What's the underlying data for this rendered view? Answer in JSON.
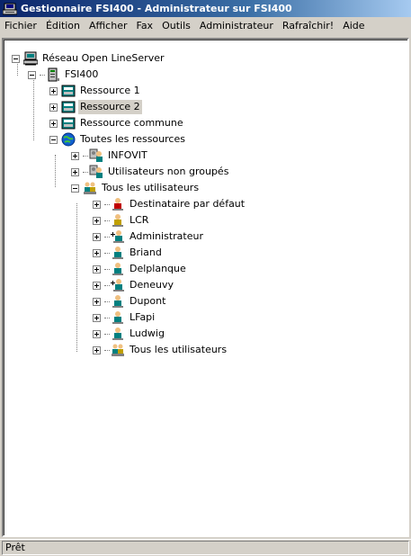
{
  "window": {
    "title": "Gestionnaire FSI400 - Administrateur sur FSI400",
    "icon": "fax-server-icon"
  },
  "menu": [
    "Fichier",
    "Édition",
    "Afficher",
    "Fax",
    "Outils",
    "Administrateur",
    "Rafraîchir!",
    "Aide"
  ],
  "tree": {
    "root": "Réseau Open LineServer",
    "server": "FSI400",
    "resources": [
      "Ressource 1",
      "Ressource 2",
      "Ressource commune"
    ],
    "all_resources": "Toutes les ressources",
    "groups": [
      "INFOVIT",
      "Utilisateurs non groupés"
    ],
    "all_users": "Tous les utilisateurs",
    "users": [
      "Destinataire par défaut",
      "LCR",
      "Administrateur",
      "Briand",
      "Delplanque",
      "Deneuvy",
      "Dupont",
      "LFapi",
      "Ludwig",
      "Tous les utilisateurs"
    ],
    "selected": "Ressource 2"
  },
  "status": {
    "text": "Prêt"
  }
}
